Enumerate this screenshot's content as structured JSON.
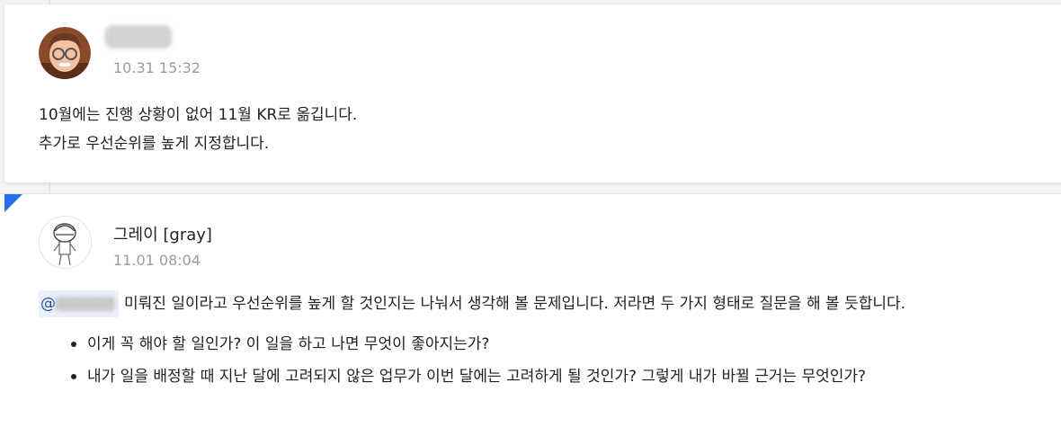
{
  "comment1": {
    "author": "",
    "timestamp": "10.31 15:32",
    "lines": [
      "10월에는 진행 상황이 없어 11월 KR로 옮깁니다.",
      "추가로 우선순위를 높게 지정합니다."
    ],
    "avatar_icon": "memoji-avatar-icon"
  },
  "comment2": {
    "author": "그레이 [gray]",
    "timestamp": "11.01 08:04",
    "mention_prefix": "@",
    "paragraph": "미뤄진 일이라고 우선순위를 높게 할 것인지는 나눠서 생각해 볼 문제입니다. 저라면 두 가지 형태로 질문을 해 볼 듯합니다.",
    "bullets": [
      "이게 꼭 해야 할 일인가? 이 일을 하고 나면 무엇이 좋아지는가?",
      "내가 일을 배정할 때 지난 달에 고려되지 않은 업무가 이번 달에는 고려하게 될 것인가? 그렇게 내가 바뀔 근거는 무엇인가?"
    ],
    "avatar_icon": "sketch-avatar-icon"
  },
  "colors": {
    "accent": "#2a6ff0",
    "timestamp": "#9a9ca0",
    "mention_bg": "#eaf0fb"
  }
}
